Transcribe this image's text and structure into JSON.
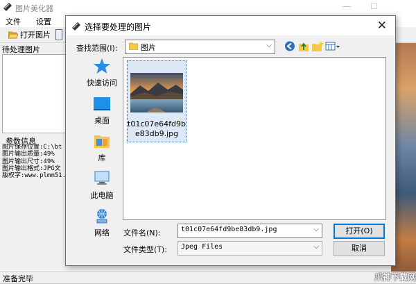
{
  "app": {
    "title": "图片美化器",
    "window_controls": [
      "—",
      "☐"
    ],
    "menu": [
      "文件",
      "设置"
    ],
    "toolbar": {
      "open_label": "打开图片"
    },
    "pending_list_header": "待处理图片",
    "params_header": "参数信息",
    "params": [
      "图片保存位置:C:\\bt",
      "图片输出质量:49%",
      "图片输出尺寸:49%",
      "图片输出格式:JPG文",
      "版权字:www.plmm51."
    ],
    "status": "准备完毕",
    "watermark": "爪神下载网"
  },
  "dialog": {
    "title": "选择要处理的图片",
    "close_icon": "✕",
    "look_in_label": "查找范围(I):",
    "look_in_value": "图片",
    "combo_arrow": "⌵",
    "places": [
      {
        "label": "快速访问",
        "icon": "star-icon"
      },
      {
        "label": "桌面",
        "icon": "desktop-icon"
      },
      {
        "label": "库",
        "icon": "library-icon"
      },
      {
        "label": "此电脑",
        "icon": "computer-icon"
      },
      {
        "label": "网络",
        "icon": "network-icon"
      }
    ],
    "files": [
      {
        "name": "t01c07e64fd9be83db9.jpg",
        "selected": true
      }
    ],
    "file_name_label": "文件名(N):",
    "file_name_value": "t01c07e64fd9be83db9.jpg",
    "file_type_label": "文件类型(T):",
    "file_type_value": "Jpeg Files",
    "open_button": "打开(O)",
    "cancel_button": "取消"
  }
}
